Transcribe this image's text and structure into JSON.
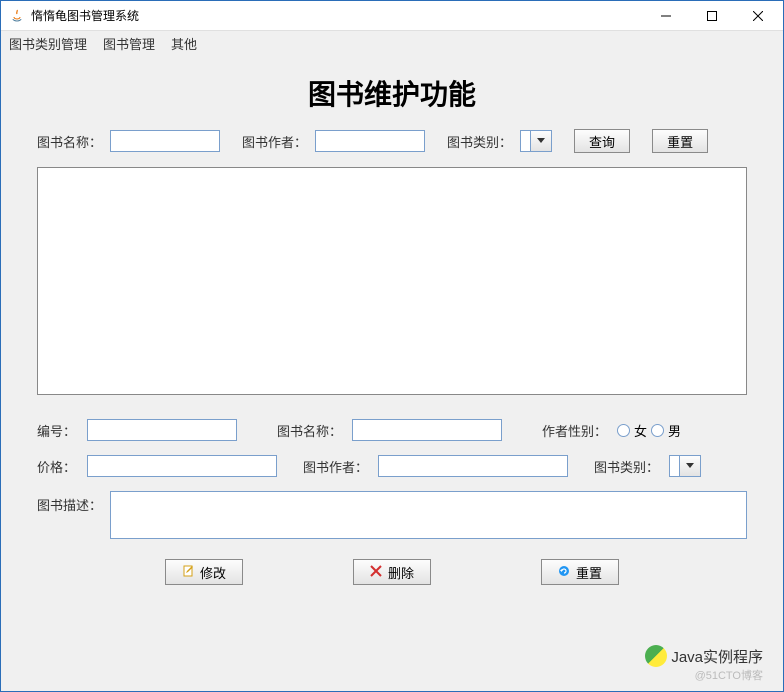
{
  "window": {
    "title": "惰惰龟图书管理系统"
  },
  "menu": {
    "category": "图书类别管理",
    "book": "图书管理",
    "other": "其他"
  },
  "heading": "图书维护功能",
  "search": {
    "name_label": "图书名称：",
    "author_label": "图书作者：",
    "category_label": "图书类别：",
    "query_btn": "查询",
    "reset_btn": "重置"
  },
  "form": {
    "id_label": "编号：",
    "name_label": "图书名称：",
    "gender_label": "作者性别：",
    "gender_female": "女",
    "gender_male": "男",
    "price_label": "价格：",
    "author_label": "图书作者：",
    "category_label": "图书类别：",
    "desc_label": "图书描述："
  },
  "actions": {
    "modify": "修改",
    "delete": "删除",
    "reset": "重置"
  },
  "watermark": {
    "main": "Java实例程序",
    "sub": "@51CTO博客"
  }
}
